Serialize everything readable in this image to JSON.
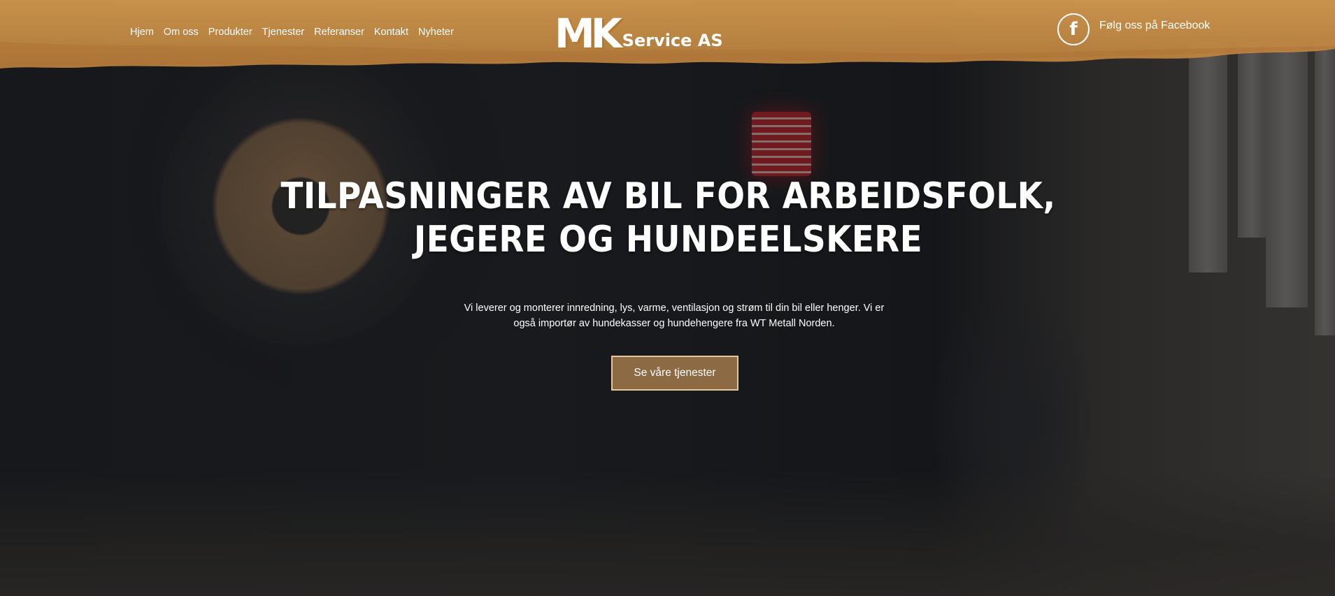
{
  "header": {
    "nav": [
      {
        "label": "Hjem"
      },
      {
        "label": "Om oss"
      },
      {
        "label": "Produkter"
      },
      {
        "label": "Tjenester"
      },
      {
        "label": "Referanser"
      },
      {
        "label": "Kontakt"
      },
      {
        "label": "Nyheter"
      }
    ],
    "logo": {
      "mark": "MK",
      "text": "Service AS"
    },
    "facebook": {
      "icon": "facebook-icon",
      "glyph": "f",
      "label": "Følg oss på Facebook"
    },
    "band_color": "#c98f47"
  },
  "hero": {
    "title_line1": "TILPASNINGER AV BIL FOR ARBEIDSFOLK,",
    "title_line2": "JEGERE OG HUNDEELSKERE",
    "text_line1": "Vi leverer og monterer innredning, lys, varme, ventilasjon og strøm til din bil eller henger. Vi er",
    "text_line2": "også importør av hundekasser og hundehengere fra WT Metall Norden.",
    "cta_label": "Se våre tjenester",
    "cta_color": "#8c6a44"
  }
}
